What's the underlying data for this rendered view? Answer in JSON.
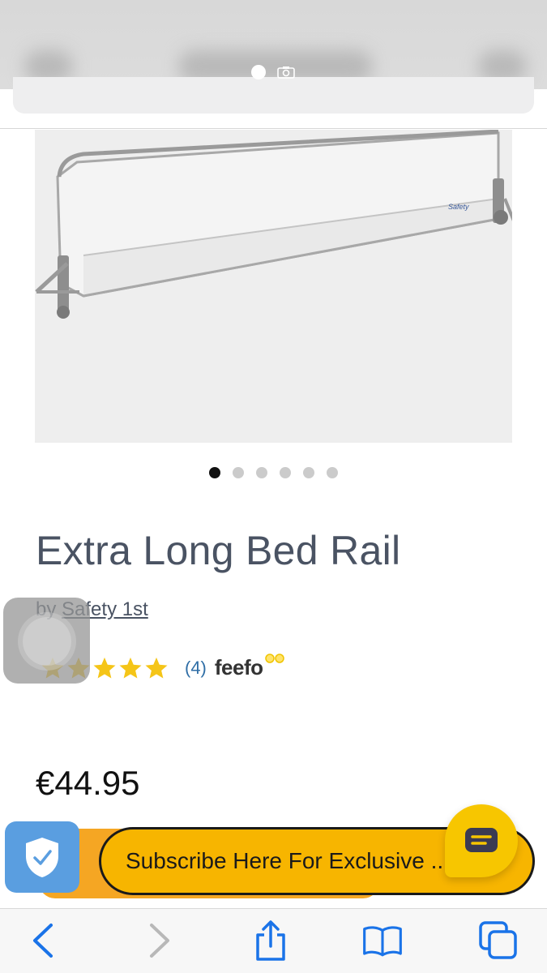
{
  "product": {
    "title": "Extra Long Bed Rail",
    "brand_prefix": "by",
    "brand_name": "Safety 1st",
    "image_logo_text": "Safety",
    "rating_stars": 5,
    "review_count": "(4)",
    "rating_provider": "feefo",
    "price": "€44.95"
  },
  "carousel": {
    "total": 6,
    "active_index": 0
  },
  "banner": {
    "subscribe_text": "Subscribe Here For Exclusive ..."
  },
  "toolbar": {
    "back_icon": "chevron-left-icon",
    "forward_icon": "chevron-right-icon",
    "share_icon": "share-icon",
    "bookmarks_icon": "book-icon",
    "tabs_icon": "tabs-icon"
  },
  "colors": {
    "accent_yellow": "#f7b500",
    "star_yellow": "#f5c518",
    "link_blue": "#2f6ea6",
    "title_gray": "#4a5363",
    "toolbar_blue": "#1a73e8"
  }
}
